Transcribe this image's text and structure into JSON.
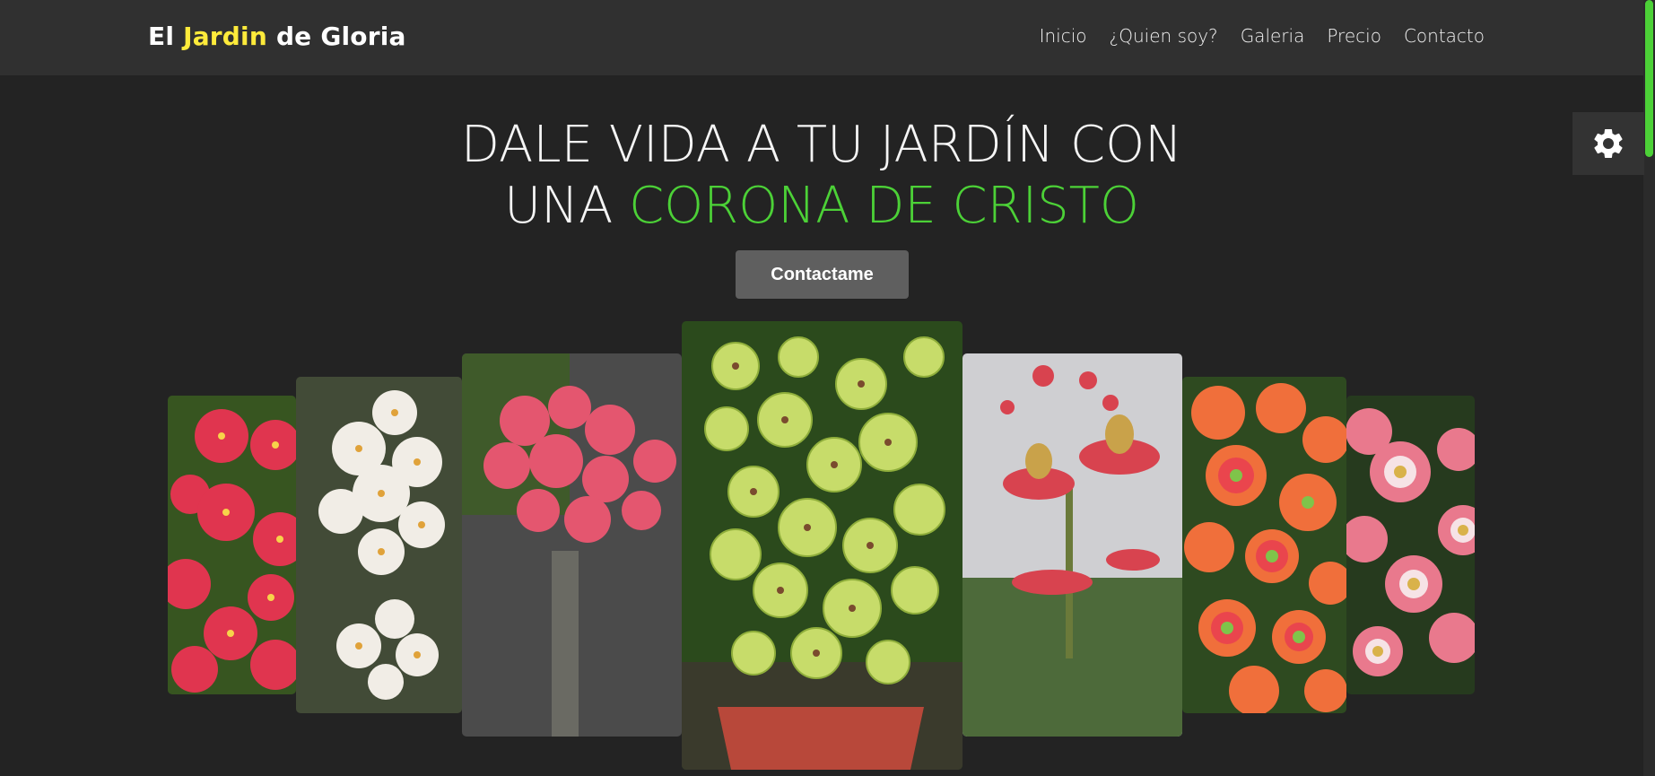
{
  "header": {
    "brand_prefix": "El",
    "brand_accent": "Jardin",
    "brand_suffix": "de Gloria",
    "nav": [
      "Inicio",
      "¿Quien soy?",
      "Galeria",
      "Precio",
      "Contacto"
    ]
  },
  "hero": {
    "line1": "DALE VIDA A TU JARDÍN CON",
    "line2_prefix": "UNA",
    "line2_highlight": "CORONA DE CRISTO",
    "cta_label": "Contactame"
  },
  "settings": {
    "icon": "gear-icon"
  },
  "colors": {
    "accent_yellow": "#ffeb3b",
    "accent_green": "#4cd137",
    "background": "#232323",
    "header": "#303030"
  },
  "gallery": {
    "items": [
      {
        "name": "red-crown-of-thorns"
      },
      {
        "name": "white-crown-of-thorns"
      },
      {
        "name": "pink-crown-of-thorns"
      },
      {
        "name": "green-crown-of-thorns"
      },
      {
        "name": "red-bud-crown-of-thorns"
      },
      {
        "name": "orange-crown-of-thorns"
      },
      {
        "name": "pink-white-crown-of-thorns"
      }
    ]
  }
}
